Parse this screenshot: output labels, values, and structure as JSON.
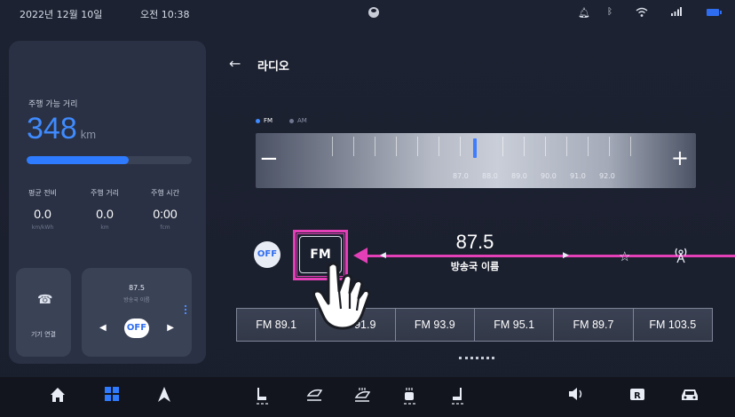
{
  "status_bar": {
    "date": "2022년 12월 10일",
    "time": "오전 10:38",
    "icons": [
      "profile-icon",
      "bell-icon",
      "bluetooth-icon",
      "wifi-icon",
      "signal-icon",
      "battery-icon"
    ]
  },
  "left_panel": {
    "range_label": "주행 가능 거리",
    "range_value": "348",
    "range_unit": "km",
    "range_fill_fraction": 0.62,
    "stats": [
      {
        "label": "평균 전비",
        "value": "0.0",
        "unit": "km/kWh"
      },
      {
        "label": "주행 거리",
        "value": "0.0",
        "unit": "km"
      },
      {
        "label": "주행 시간",
        "value": "0:00",
        "unit": "fcm"
      }
    ],
    "connect_label": "기기 연결",
    "mini_radio": {
      "frequency": "87.5",
      "station": "방송국 이름",
      "off_label": "OFF"
    }
  },
  "header": {
    "title": "라디오"
  },
  "bands": {
    "fm": "FM",
    "am": "AM",
    "active": "FM"
  },
  "tuner": {
    "ticks": [
      "87.0",
      "88.0",
      "89.0",
      "90.0",
      "91.0",
      "92.0"
    ],
    "minus": "−",
    "plus": "+"
  },
  "now_playing": {
    "off_label": "OFF",
    "band_button": "FM",
    "frequency": "87.5",
    "station": "방송국 이름"
  },
  "presets": [
    "FM 89.1",
    "FM 91.9",
    "FM 93.9",
    "FM 95.1",
    "FM 89.7",
    "FM 103.5"
  ],
  "colors": {
    "accent": "#2f7bff",
    "highlight": "#e33fb7",
    "panel": "#2a3144",
    "background": "#1c2130"
  }
}
